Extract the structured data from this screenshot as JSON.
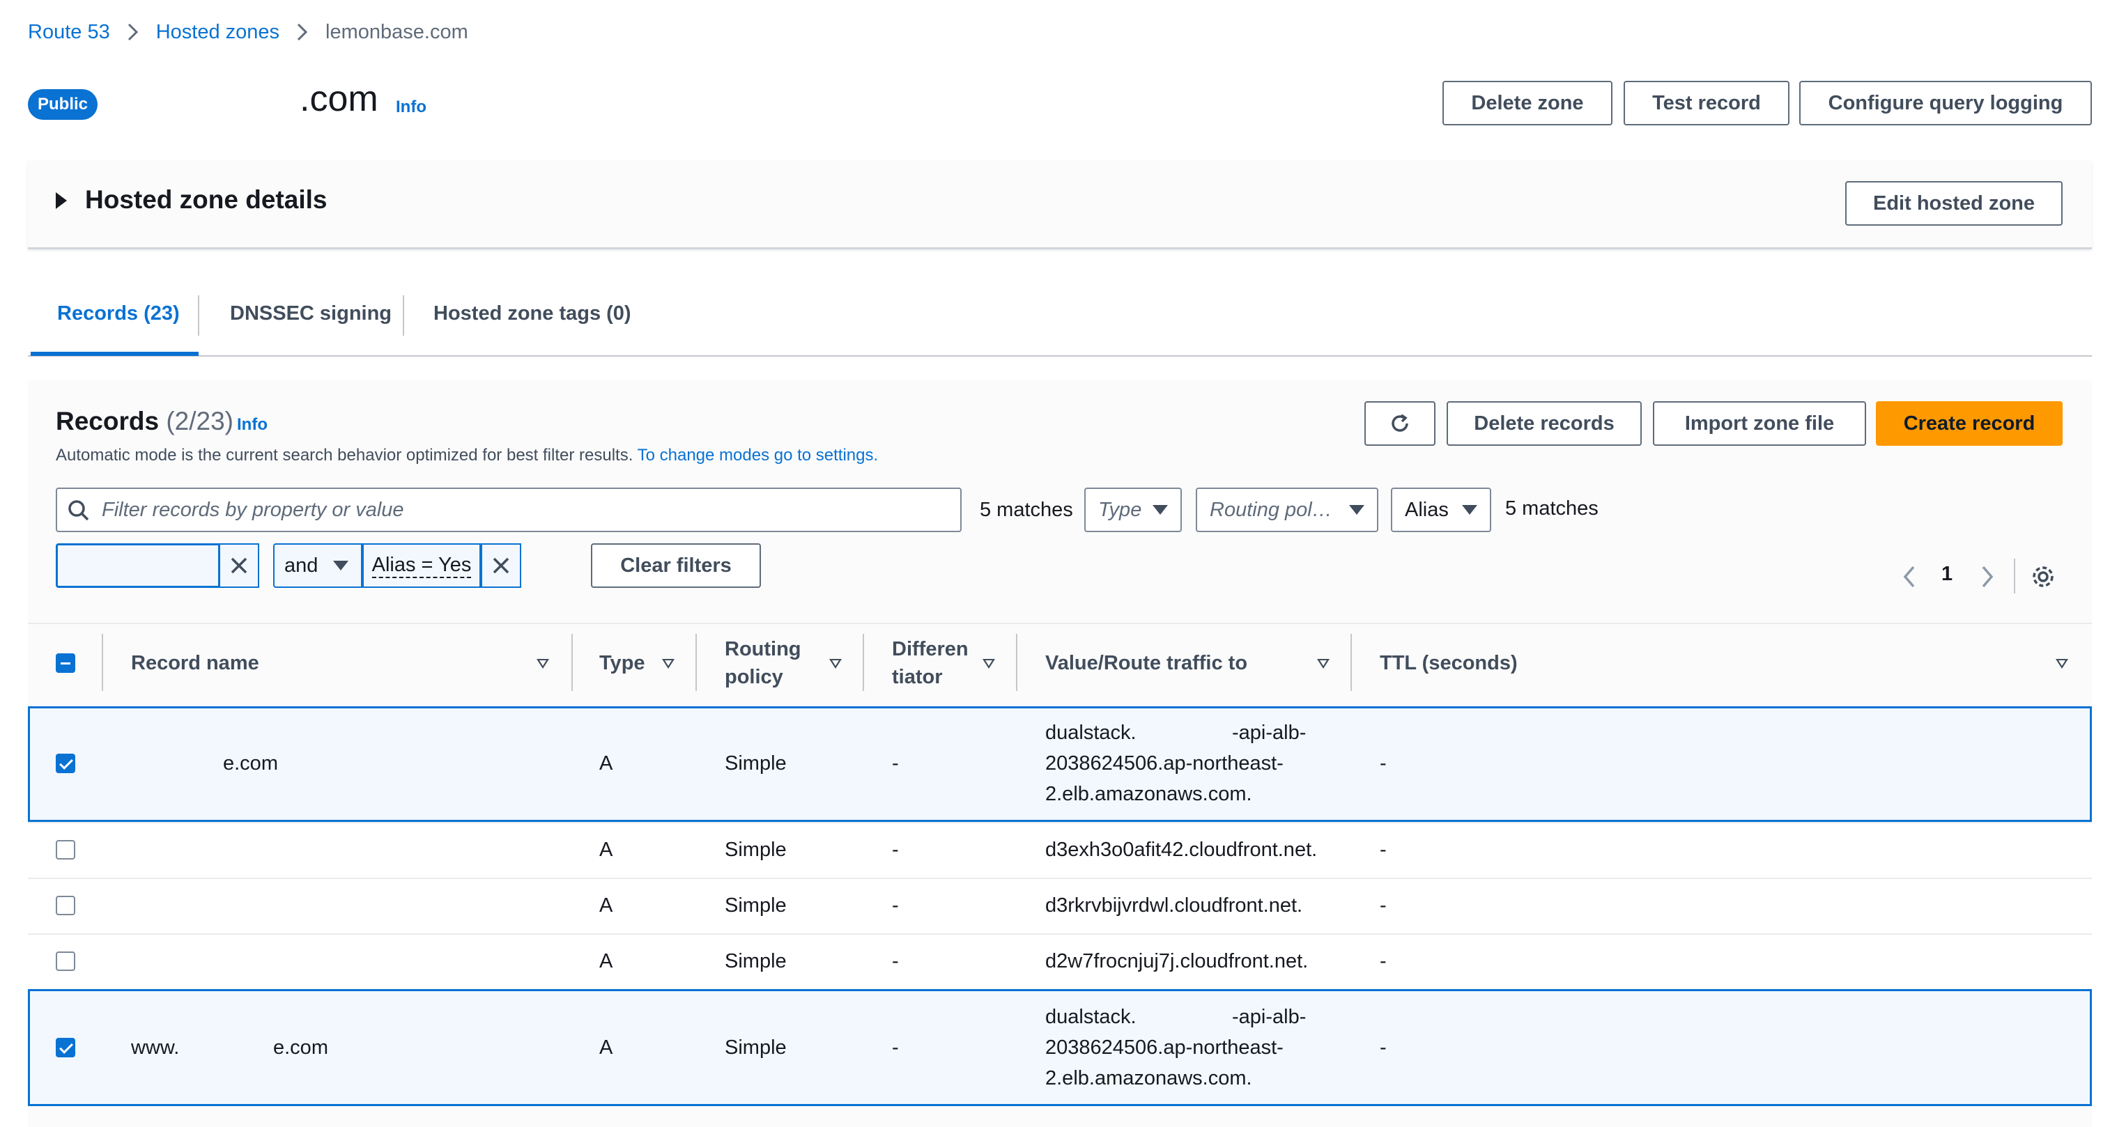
{
  "breadcrumb": {
    "items": [
      "Route 53",
      "Hosted zones"
    ],
    "current": "lemonbase.com"
  },
  "header": {
    "badge": "Public",
    "zone_name": ".com",
    "info": "Info",
    "delete_zone": "Delete zone",
    "test_record": "Test record",
    "configure_logging": "Configure query logging"
  },
  "details": {
    "title": "Hosted zone details",
    "edit_button": "Edit hosted zone"
  },
  "tabs": [
    "Records (23)",
    "DNSSEC signing",
    "Hosted zone tags (0)"
  ],
  "records": {
    "title": "Records",
    "count": "(2/23)",
    "info": "Info",
    "description": "Automatic mode is the current search behavior optimized for best filter results.",
    "settings_link": "To change modes go to settings.",
    "delete_button": "Delete records",
    "import_button": "Import zone file",
    "create_button": "Create record"
  },
  "filters": {
    "search_placeholder": "Filter records by property or value",
    "matches_left": "5 matches",
    "type_placeholder": "Type",
    "routing_placeholder": "Routing pol…",
    "alias_value": "Alias",
    "matches_right": "5 matches",
    "and_label": "and",
    "alias_token": "Alias = Yes",
    "clear_filters": "Clear filters"
  },
  "pagination": {
    "page": "1"
  },
  "table": {
    "columns": {
      "name": "Record name",
      "type": "Type",
      "routing_1": "Routing",
      "routing_2": "policy",
      "diff_1": "Differen",
      "diff_2": "tiator",
      "value": "Value/Route traffic to",
      "ttl": "TTL (seconds)"
    },
    "rows": [
      {
        "name": "e.com",
        "type": "A",
        "routing": "Simple",
        "diff": "-",
        "value_1": "dualstack.",
        "value_1b": "-api-alb-",
        "value_2": "2038624506.ap-northeast-",
        "value_3": "2.elb.amazonaws.com.",
        "ttl": "-"
      },
      {
        "name": "",
        "type": "A",
        "routing": "Simple",
        "diff": "-",
        "value_1": "d3exh3o0afit42.cloudfront.net.",
        "ttl": "-"
      },
      {
        "name": "",
        "type": "A",
        "routing": "Simple",
        "diff": "-",
        "value_1": "d3rkrvbijvrdwl.cloudfront.net.",
        "ttl": "-"
      },
      {
        "name": "",
        "type": "A",
        "routing": "Simple",
        "diff": "-",
        "value_1": "d2w7frocnjuj7j.cloudfront.net.",
        "ttl": "-"
      },
      {
        "name_a": "www.",
        "name_b": "e.com",
        "type": "A",
        "routing": "Simple",
        "diff": "-",
        "value_1": "dualstack.",
        "value_1b": "-api-alb-",
        "value_2": "2038624506.ap-northeast-",
        "value_3": "2.elb.amazonaws.com.",
        "ttl": "-"
      }
    ]
  }
}
